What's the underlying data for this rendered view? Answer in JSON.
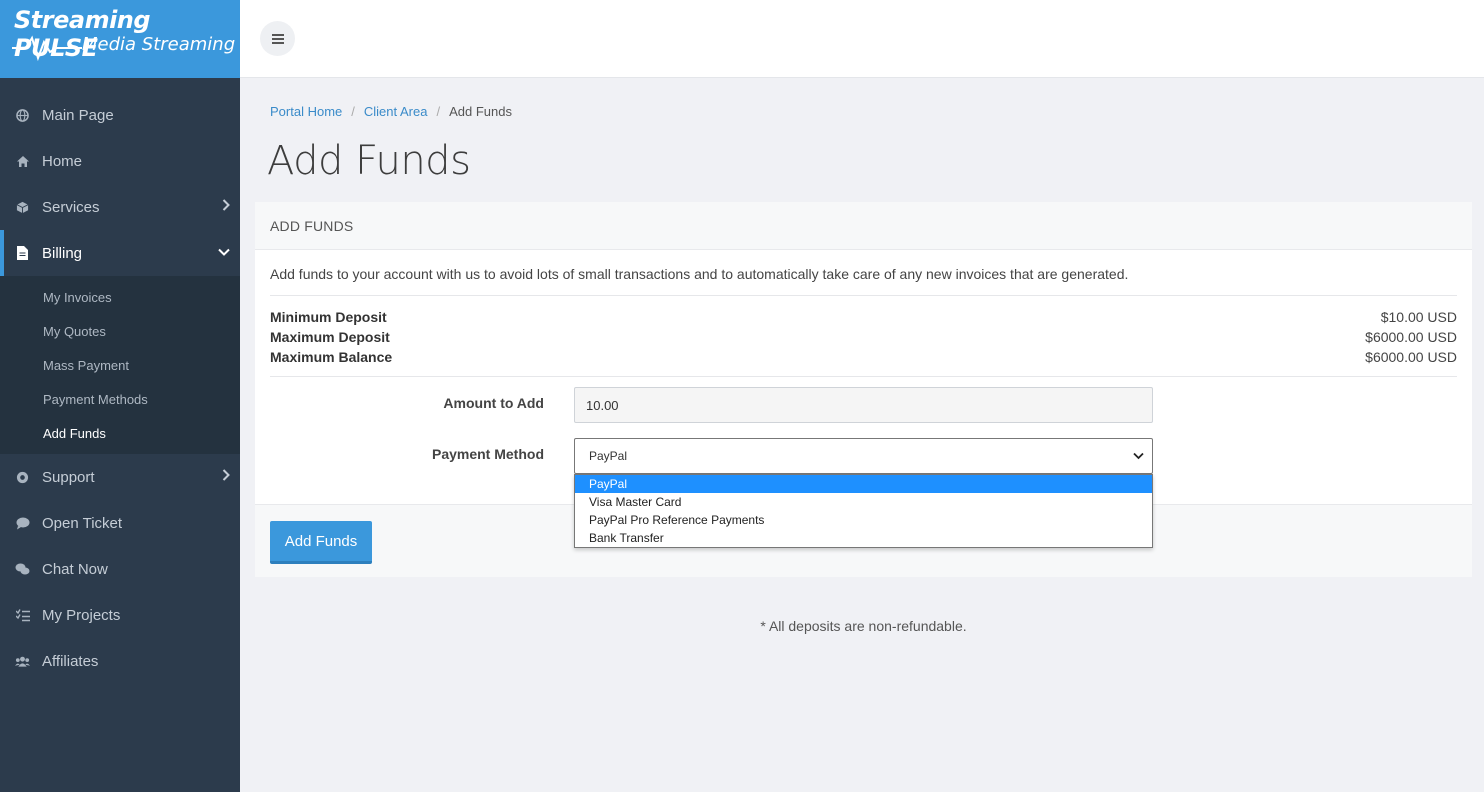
{
  "brand": {
    "line1": "Streaming PULSE",
    "line2": "Media Streaming"
  },
  "sidebar": {
    "items": [
      {
        "label": "Main Page",
        "icon": "globe-icon"
      },
      {
        "label": "Home",
        "icon": "home-icon"
      },
      {
        "label": "Services",
        "icon": "cube-icon"
      },
      {
        "label": "Billing",
        "icon": "document-icon"
      },
      {
        "label": "Support",
        "icon": "life-ring-icon"
      },
      {
        "label": "Open Ticket",
        "icon": "comment-icon"
      },
      {
        "label": "Chat Now",
        "icon": "comments-icon"
      },
      {
        "label": "My Projects",
        "icon": "tasks-icon"
      },
      {
        "label": "Affiliates",
        "icon": "users-icon"
      }
    ],
    "billing_sub": [
      {
        "label": "My Invoices"
      },
      {
        "label": "My Quotes"
      },
      {
        "label": "Mass Payment"
      },
      {
        "label": "Payment Methods"
      },
      {
        "label": "Add Funds"
      }
    ]
  },
  "breadcrumb": {
    "home": "Portal Home",
    "client": "Client Area",
    "current": "Add Funds"
  },
  "page": {
    "title": "Add Funds"
  },
  "card": {
    "header": "ADD FUNDS",
    "intro": "Add funds to your account with us to avoid lots of small transactions and to automatically take care of any new invoices that are generated.",
    "limits": [
      {
        "label": "Minimum Deposit",
        "value": "$10.00 USD"
      },
      {
        "label": "Maximum Deposit",
        "value": "$6000.00 USD"
      },
      {
        "label": "Maximum Balance",
        "value": "$6000.00 USD"
      }
    ],
    "amount_label": "Amount to Add",
    "amount_value": "10.00",
    "method_label": "Payment Method",
    "method_selected": "PayPal",
    "method_options": [
      "PayPal",
      "Visa Master Card",
      "PayPal Pro Reference Payments",
      "Bank Transfer"
    ],
    "submit_label": "Add Funds"
  },
  "note": "* All deposits are non-refundable.",
  "colors": {
    "accent": "#3b98dc",
    "sidebar": "#2c3b4c",
    "option_highlight": "#1e90ff"
  }
}
